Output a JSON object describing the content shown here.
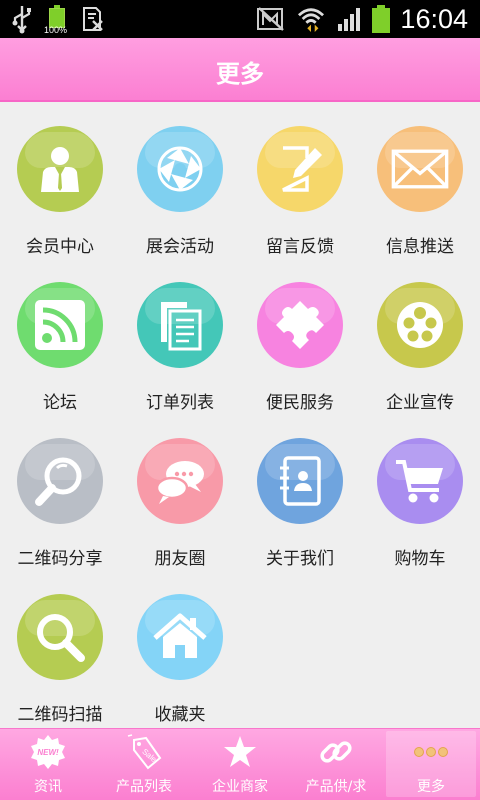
{
  "status_bar": {
    "battery_percent": "100%",
    "time": "16:04",
    "icons": [
      "usb-icon",
      "battery-full-icon",
      "sd-card-icon",
      "mute-icon",
      "wifi-icon",
      "signal-icon",
      "battery-icon"
    ]
  },
  "header": {
    "title": "更多"
  },
  "grid": {
    "items": [
      {
        "label": "会员中心",
        "icon": "member-icon",
        "color": "#b5cc52"
      },
      {
        "label": "展会活动",
        "icon": "exhibition-icon",
        "color": "#7fd0f0"
      },
      {
        "label": "留言反馈",
        "icon": "feedback-icon",
        "color": "#f6d76a"
      },
      {
        "label": "信息推送",
        "icon": "mail-icon",
        "color": "#f7bf7a"
      },
      {
        "label": "论坛",
        "icon": "rss-icon",
        "color": "#6fdc6f"
      },
      {
        "label": "订单列表",
        "icon": "document-list-icon",
        "color": "#44c7b8"
      },
      {
        "label": "便民服务",
        "icon": "puzzle-icon",
        "color": "#f783e0"
      },
      {
        "label": "企业宣传",
        "icon": "film-reel-icon",
        "color": "#c7c84c"
      },
      {
        "label": "二维码分享",
        "icon": "magnifier-icon",
        "color": "#b9bec6"
      },
      {
        "label": "朋友圈",
        "icon": "chat-bubbles-icon",
        "color": "#f89aa8"
      },
      {
        "label": "关于我们",
        "icon": "contact-book-icon",
        "color": "#6fa4de"
      },
      {
        "label": "购物车",
        "icon": "shopping-cart-icon",
        "color": "#a98df0"
      },
      {
        "label": "二维码扫描",
        "icon": "search-icon",
        "color": "#b5cc52"
      },
      {
        "label": "收藏夹",
        "icon": "home-icon",
        "color": "#84d4f7"
      }
    ]
  },
  "bottom_nav": {
    "items": [
      {
        "label": "资讯",
        "icon": "new-badge-icon",
        "active": false
      },
      {
        "label": "产品列表",
        "icon": "sale-tag-icon",
        "active": false
      },
      {
        "label": "企业商家",
        "icon": "star-icon",
        "active": false
      },
      {
        "label": "产品供/求",
        "icon": "link-icon",
        "active": false
      },
      {
        "label": "更多",
        "icon": "more-dots-icon",
        "active": true
      }
    ]
  },
  "colors": {
    "header_pink": "#fb7fd2",
    "nav_pink": "#fb7fd0",
    "background": "#efefef"
  }
}
